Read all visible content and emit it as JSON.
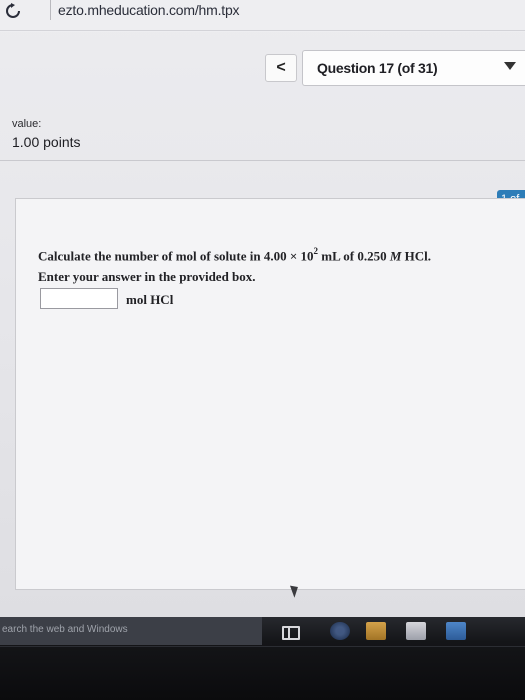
{
  "browser": {
    "url": "ezto.mheducation.com/hm.tpx",
    "refresh_icon": "refresh-icon"
  },
  "navigator": {
    "back_icon": "chevron-left-icon",
    "back_glyph": "<",
    "question_label": "Question 17 (of 31)",
    "dropdown_icon": "caret-down-icon"
  },
  "question_info": {
    "value_label": "value:",
    "points": "1.00 points"
  },
  "panel": {
    "tab_label": "1 of",
    "question_prefix": "Calculate the number of mol of solute in ",
    "volume_mantissa": "4.00 × 10",
    "volume_exponent": "2",
    "volume_unit": " mL of 0.250 ",
    "molarity_symbol": "M",
    "solute": " HCl.",
    "instruction": "Enter your answer in the provided box.",
    "answer_value": "",
    "answer_unit": "mol HCl"
  },
  "taskbar": {
    "search_text": "earch the web and Windows",
    "icons": [
      "task-view-icon",
      "edge-icon",
      "file-explorer-icon",
      "store-icon",
      "mail-icon"
    ]
  }
}
